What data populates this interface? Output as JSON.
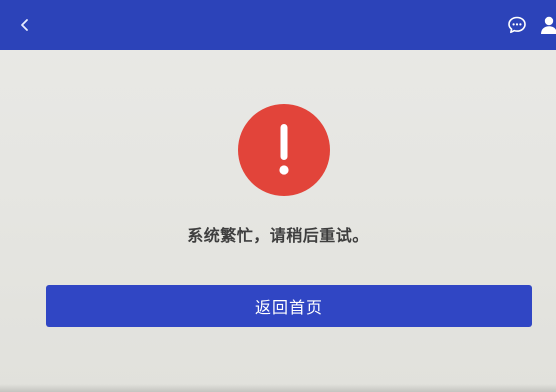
{
  "header": {
    "back_icon": "chevron-left-icon",
    "chat_icon": "chat-bubble-icon",
    "user_icon": "user-icon",
    "bar_color": "#2c43b9"
  },
  "main": {
    "alert_icon": "exclamation-icon",
    "alert_color": "#e2443a",
    "message": "系统繁忙，请稍后重试。",
    "return_button_label": "返回首页",
    "button_color": "#3046c4"
  }
}
